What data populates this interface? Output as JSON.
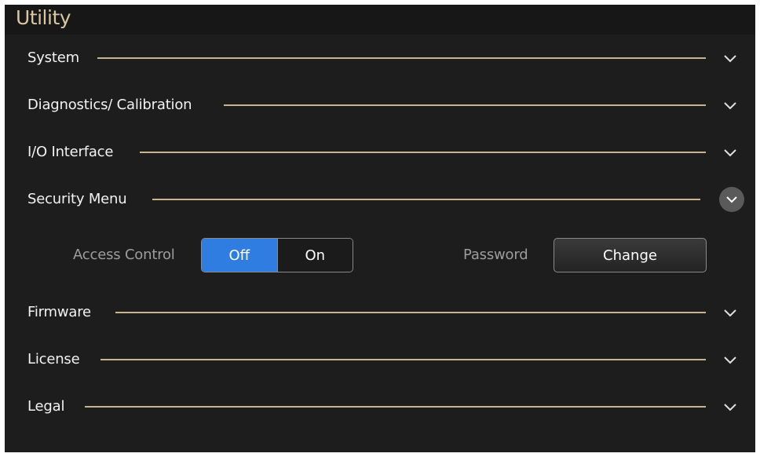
{
  "window": {
    "title": "Utility"
  },
  "sections": [
    {
      "label": "System",
      "expanded": false
    },
    {
      "label": "Diagnostics/ Calibration",
      "expanded": false
    },
    {
      "label": "I/O Interface",
      "expanded": false
    },
    {
      "label": "Security Menu",
      "expanded": true
    },
    {
      "label": "Firmware",
      "expanded": false
    },
    {
      "label": "License",
      "expanded": false
    },
    {
      "label": "Legal",
      "expanded": false
    }
  ],
  "security": {
    "access_control_label": "Access Control",
    "toggle_off_label": "Off",
    "toggle_on_label": "On",
    "selected": "Off",
    "password_label": "Password",
    "change_button_label": "Change"
  },
  "colors": {
    "panel_bg": "#1d1d1d",
    "title_color": "#d9c7a4",
    "divider_line": "#c9b48c",
    "toggle_active": "#2f7de1"
  },
  "icons": {
    "collapsed": "chevron-down-icon",
    "expanded": "chevron-down-circle-icon"
  }
}
